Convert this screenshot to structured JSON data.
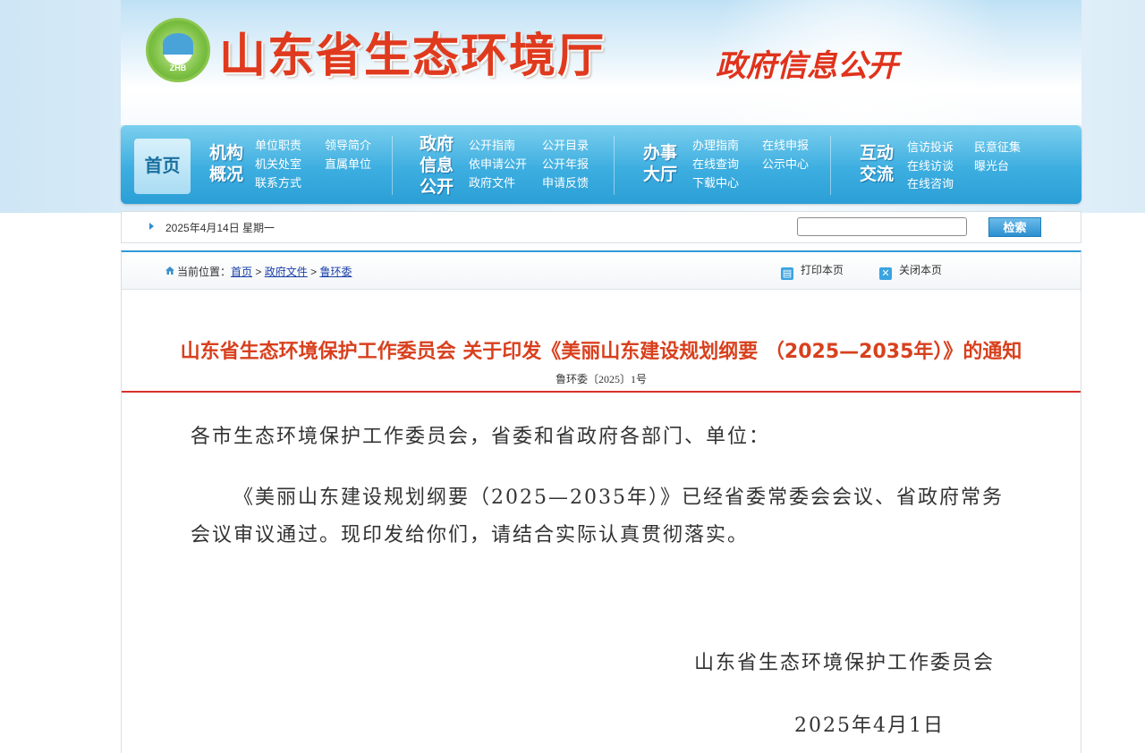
{
  "banner": {
    "logo_text": "ZHB",
    "site_title": "山东省生态环境厅",
    "subtitle": "政府信息公开"
  },
  "nav": {
    "home": "首页",
    "groups": [
      {
        "title": [
          "机构",
          "概况"
        ],
        "links": [
          "单位职责",
          "领导简介",
          "机关处室",
          "直属单位",
          "联系方式"
        ]
      },
      {
        "title": [
          "政府",
          "信息",
          "公开"
        ],
        "links": [
          "公开指南",
          "公开目录",
          "依申请公开",
          "公开年报",
          "政府文件",
          "申请反馈"
        ]
      },
      {
        "title": [
          "办事",
          "大厅"
        ],
        "links": [
          "办理指南",
          "在线申报",
          "在线查询",
          "公示中心",
          "下载中心"
        ]
      },
      {
        "title": [
          "互动",
          "交流"
        ],
        "links": [
          "信访投诉",
          "民意征集",
          "在线访谈",
          "曝光台",
          "在线咨询"
        ]
      }
    ]
  },
  "searchbar": {
    "date": "2025年4月14日 星期一",
    "search_value": "",
    "search_button": "检索"
  },
  "breadcrumb": {
    "prefix": "当前位置：",
    "items": [
      "首页",
      "政府文件",
      "鲁环委"
    ],
    "separator": ">",
    "print": "打印本页",
    "close": "关闭本页"
  },
  "article": {
    "title": "山东省生态环境保护工作委员会 关于印发《美丽山东建设规划纲要 （2025—2035年）》的通知",
    "doc_no": "鲁环委〔2025〕1号",
    "salutation": "各市生态环境保护工作委员会，省委和省政府各部门、单位：",
    "paragraph": "《美丽山东建设规划纲要（2025—2035年）》已经省委常委会会议、省政府常务会议审议通过。现印发给你们，请结合实际认真贯彻落实。",
    "signer": "山东省生态环境保护工作委员会",
    "date": "2025年4月1日"
  },
  "colors": {
    "title_red": "#d8401e",
    "nav_blue": "#2b9fd6",
    "redline": "#d8312a"
  }
}
